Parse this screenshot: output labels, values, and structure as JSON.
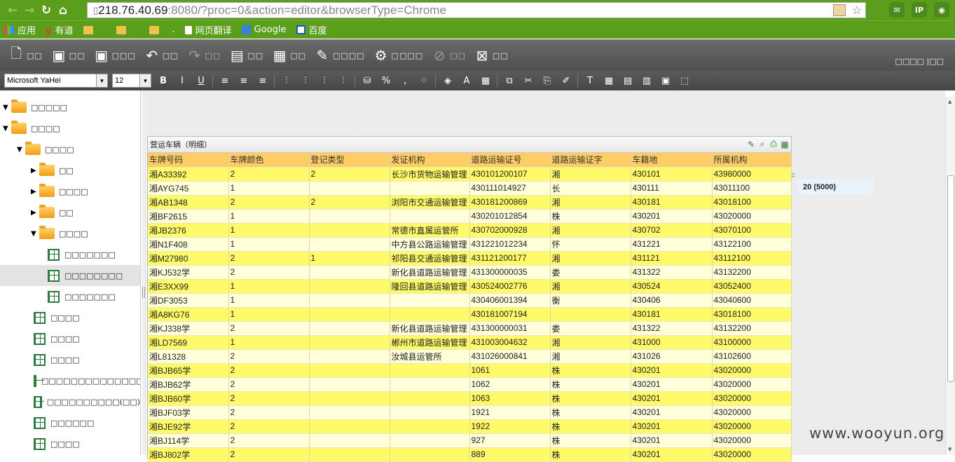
{
  "browser": {
    "url_host": "218.76.40.69",
    "url_rest": ":8080/?proc=0&action=editor&browserType=Chrome",
    "bookmarks": [
      "应用",
      "有道",
      "",
      "",
      "",
      ".",
      "网页翻译",
      "Google",
      "百度"
    ],
    "ext_icons": [
      "gmail-icon",
      "ip-icon",
      "camera-icon"
    ]
  },
  "toolbar1": {
    "buttons": [
      {
        "icon": "new-file-icon",
        "glyph": "🗋",
        "label": "□□",
        "disabled": false
      },
      {
        "icon": "save-icon",
        "glyph": "▣",
        "label": "□□",
        "disabled": false
      },
      {
        "icon": "save-as-icon",
        "glyph": "▣",
        "label": "□□□",
        "disabled": false
      },
      {
        "icon": "undo-icon",
        "glyph": "↶",
        "label": "□□",
        "disabled": false
      },
      {
        "icon": "redo-icon",
        "glyph": "↷",
        "label": "□□",
        "disabled": true
      },
      {
        "icon": "preview-icon",
        "glyph": "▤",
        "label": "□□",
        "disabled": false
      },
      {
        "icon": "layout-icon",
        "glyph": "▦",
        "label": "□□",
        "disabled": false
      },
      {
        "icon": "edit-icon",
        "glyph": "✎",
        "label": "□□□□",
        "disabled": false
      },
      {
        "icon": "settings-grid-icon",
        "glyph": "⚙",
        "label": "□□□□",
        "disabled": false
      },
      {
        "icon": "cancel-icon",
        "glyph": "⊘",
        "label": "□□",
        "disabled": true
      },
      {
        "icon": "close-icon",
        "glyph": "⊠",
        "label": "□□",
        "disabled": false
      }
    ],
    "right_text": "□□□□ |□□"
  },
  "toolbar2": {
    "font_family": "Microsoft YaHei",
    "font_size": "12",
    "tools": [
      "B",
      "I",
      "U",
      "≡",
      "≡",
      "≡",
      "⫶",
      "⫶",
      "⫶",
      "⫶",
      "⛁",
      "%",
      "‚",
      "⁘",
      "◈",
      "A",
      "▦",
      "⧉",
      "✂",
      "⎘",
      "✐",
      "T",
      "▦",
      "▤",
      "▥",
      "▣",
      "⬚"
    ]
  },
  "tree": [
    {
      "label": "□□□□□",
      "level": 0,
      "type": "folder",
      "expanded": true,
      "selected": false
    },
    {
      "label": "□□□□",
      "level": 0,
      "type": "folder",
      "expanded": true,
      "selected": false
    },
    {
      "label": "□□□□",
      "level": 1,
      "type": "folder",
      "expanded": true,
      "selected": false
    },
    {
      "label": "□□",
      "level": 2,
      "type": "folder",
      "expanded": false,
      "selected": false
    },
    {
      "label": "□□□□",
      "level": 2,
      "type": "folder",
      "expanded": false,
      "selected": false
    },
    {
      "label": "□□",
      "level": 2,
      "type": "folder",
      "expanded": false,
      "selected": false
    },
    {
      "label": "□□□□",
      "level": 2,
      "type": "folder",
      "expanded": true,
      "selected": false
    },
    {
      "label": "□□□□□□□",
      "level": 3,
      "type": "report",
      "selected": false
    },
    {
      "label": "□□□□□□□□",
      "level": 3,
      "type": "report",
      "selected": true
    },
    {
      "label": "□□□□□□□",
      "level": 3,
      "type": "report",
      "selected": false
    },
    {
      "label": "□□□□",
      "level": 2,
      "type": "report",
      "selected": false
    },
    {
      "label": "□□□□",
      "level": 2,
      "type": "report",
      "selected": false
    },
    {
      "label": "□□□□",
      "level": 2,
      "type": "report",
      "selected": false
    },
    {
      "label": "□□□□□□□□□□□□□□",
      "level": 2,
      "type": "report",
      "selected": false
    },
    {
      "label": "□□□□□□□□□□(□□)",
      "level": 2,
      "type": "report",
      "selected": false
    },
    {
      "label": "□□□□□□",
      "level": 2,
      "type": "report",
      "selected": false
    },
    {
      "label": "□□□□",
      "level": 2,
      "type": "report",
      "selected": false
    }
  ],
  "panel": {
    "title": "营运车辆（明细）",
    "columns": [
      "车牌号码",
      "车牌颜色",
      "登记类型",
      "发证机构",
      "道路运输证号",
      "道路运输证字",
      "车籍地",
      "所属机构"
    ],
    "rows": [
      [
        "湘A33392",
        "2",
        "2",
        "长沙市货物运输管理",
        "430101200107",
        "湘",
        "430101",
        "43980000"
      ],
      [
        "湘AYG745",
        "1",
        "",
        "",
        "430111014927",
        "长",
        "430111",
        "43011100"
      ],
      [
        "湘AB1348",
        "2",
        "2",
        "浏阳市交通运输管理",
        "430181200869",
        "湘",
        "430181",
        "43018100"
      ],
      [
        "湘BF2615",
        "1",
        "",
        "",
        "430201012854",
        "株",
        "430201",
        "43020000"
      ],
      [
        "湘JB2376",
        "1",
        "",
        "常德市直属运管所",
        "430702000928",
        "湘",
        "430702",
        "43070100"
      ],
      [
        "湘N1F408",
        "1",
        "",
        "中方县公路运输管理",
        "431221012234",
        "怀",
        "431221",
        "43122100"
      ],
      [
        "湘M27980",
        "2",
        "1",
        "祁阳县交通运输管理",
        "431121200177",
        "湘",
        "431121",
        "43112100"
      ],
      [
        "湘KJ532学",
        "2",
        "",
        "新化县道路运输管理",
        "431300000035",
        "娄",
        "431322",
        "43132200"
      ],
      [
        "湘E3XX99",
        "1",
        "",
        "隆回县道路运输管理",
        "430524002776",
        "湘",
        "430524",
        "43052400"
      ],
      [
        "湘DF3053",
        "1",
        "",
        "",
        "430406001394",
        "衡",
        "430406",
        "43040600"
      ],
      [
        "湘A8KG76",
        "1",
        "",
        "",
        "430181007194",
        "",
        "430181",
        "43018100"
      ],
      [
        "湘KJ338学",
        "2",
        "",
        "新化县道路运输管理",
        "431300000031",
        "娄",
        "431322",
        "43132200"
      ],
      [
        "湘LD7569",
        "1",
        "",
        "郴州市道路运输管理",
        "431003004632",
        "湘",
        "431000",
        "43100000"
      ],
      [
        "湘L81328",
        "2",
        "",
        "汝城县运管所",
        "431026000841",
        "湘",
        "431026",
        "43102600"
      ],
      [
        "湘BJB65学",
        "2",
        "",
        "",
        "1061",
        "株",
        "430201",
        "43020000"
      ],
      [
        "湘BJB62学",
        "2",
        "",
        "",
        "1062",
        "株",
        "430201",
        "43020000"
      ],
      [
        "湘BJB60学",
        "2",
        "",
        "",
        "1063",
        "株",
        "430201",
        "43020000"
      ],
      [
        "湘BJF03学",
        "2",
        "",
        "",
        "1921",
        "株",
        "430201",
        "43020000"
      ],
      [
        "湘BJE92学",
        "2",
        "",
        "",
        "1922",
        "株",
        "430201",
        "43020000"
      ],
      [
        "湘BJ114学",
        "2",
        "",
        "",
        "927",
        "株",
        "430201",
        "43020000"
      ],
      [
        "湘BJ802学",
        "2",
        "",
        "",
        "889",
        "株",
        "430201",
        "43020000"
      ]
    ]
  },
  "count_label": "20 (5000)",
  "watermark": "www.wooyun.org"
}
